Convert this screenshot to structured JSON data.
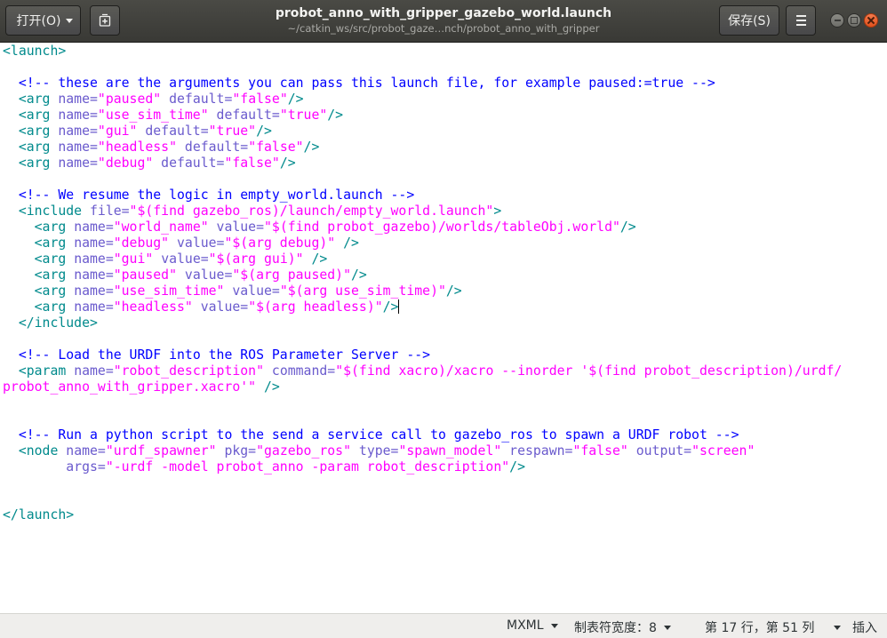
{
  "header": {
    "open_label": "打开(O)",
    "save_label": "保存(S)",
    "title": "probot_anno_with_gripper_gazebo_world.launch",
    "subtitle": "~/catkin_ws/src/probot_gaze…nch/probot_anno_with_gripper"
  },
  "editor": {
    "lines": [
      [
        [
          "t",
          "<launch>"
        ]
      ],
      [],
      [
        [
          "t",
          "  "
        ],
        [
          "c",
          "<!-- these are the arguments you can pass this launch file, for example paused:=true -->"
        ]
      ],
      [
        [
          "t",
          "  <arg "
        ],
        [
          "a",
          "name="
        ],
        [
          "v",
          "\"paused\""
        ],
        [
          "a",
          " default="
        ],
        [
          "v",
          "\"false\""
        ],
        [
          "t",
          "/>"
        ]
      ],
      [
        [
          "t",
          "  <arg "
        ],
        [
          "a",
          "name="
        ],
        [
          "v",
          "\"use_sim_time\""
        ],
        [
          "a",
          " default="
        ],
        [
          "v",
          "\"true\""
        ],
        [
          "t",
          "/>"
        ]
      ],
      [
        [
          "t",
          "  <arg "
        ],
        [
          "a",
          "name="
        ],
        [
          "v",
          "\"gui\""
        ],
        [
          "a",
          " default="
        ],
        [
          "v",
          "\"true\""
        ],
        [
          "t",
          "/>"
        ]
      ],
      [
        [
          "t",
          "  <arg "
        ],
        [
          "a",
          "name="
        ],
        [
          "v",
          "\"headless\""
        ],
        [
          "a",
          " default="
        ],
        [
          "v",
          "\"false\""
        ],
        [
          "t",
          "/>"
        ]
      ],
      [
        [
          "t",
          "  <arg "
        ],
        [
          "a",
          "name="
        ],
        [
          "v",
          "\"debug\""
        ],
        [
          "a",
          " default="
        ],
        [
          "v",
          "\"false\""
        ],
        [
          "t",
          "/>"
        ]
      ],
      [],
      [
        [
          "t",
          "  "
        ],
        [
          "c",
          "<!-- We resume the logic in empty_world.launch -->"
        ]
      ],
      [
        [
          "t",
          "  <include "
        ],
        [
          "a",
          "file="
        ],
        [
          "v",
          "\"$(find gazebo_ros)/launch/empty_world.launch\""
        ],
        [
          "t",
          ">"
        ]
      ],
      [
        [
          "t",
          "    <arg "
        ],
        [
          "a",
          "name="
        ],
        [
          "v",
          "\"world_name\""
        ],
        [
          "a",
          " value="
        ],
        [
          "v",
          "\"$(find probot_gazebo)/worlds/tableObj.world\""
        ],
        [
          "t",
          "/>"
        ]
      ],
      [
        [
          "t",
          "    <arg "
        ],
        [
          "a",
          "name="
        ],
        [
          "v",
          "\"debug\""
        ],
        [
          "a",
          " value="
        ],
        [
          "v",
          "\"$(arg debug)\""
        ],
        [
          "t",
          " />"
        ]
      ],
      [
        [
          "t",
          "    <arg "
        ],
        [
          "a",
          "name="
        ],
        [
          "v",
          "\"gui\""
        ],
        [
          "a",
          " value="
        ],
        [
          "v",
          "\"$(arg gui)\""
        ],
        [
          "t",
          " />"
        ]
      ],
      [
        [
          "t",
          "    <arg "
        ],
        [
          "a",
          "name="
        ],
        [
          "v",
          "\"paused\""
        ],
        [
          "a",
          " value="
        ],
        [
          "v",
          "\"$(arg paused)\""
        ],
        [
          "t",
          "/>"
        ]
      ],
      [
        [
          "t",
          "    <arg "
        ],
        [
          "a",
          "name="
        ],
        [
          "v",
          "\"use_sim_time\""
        ],
        [
          "a",
          " value="
        ],
        [
          "v",
          "\"$(arg use_sim_time)\""
        ],
        [
          "t",
          "/>"
        ]
      ],
      [
        [
          "t",
          "    <arg "
        ],
        [
          "a",
          "name="
        ],
        [
          "v",
          "\"headless\""
        ],
        [
          "a",
          " value="
        ],
        [
          "v",
          "\"$(arg headless)\""
        ],
        [
          "t",
          "/>"
        ],
        [
          "cursor",
          ""
        ]
      ],
      [
        [
          "t",
          "  </include>"
        ]
      ],
      [],
      [
        [
          "t",
          "  "
        ],
        [
          "c",
          "<!-- Load the URDF into the ROS Parameter Server -->"
        ]
      ],
      [
        [
          "t",
          "  <param "
        ],
        [
          "a",
          "name="
        ],
        [
          "v",
          "\"robot_description\""
        ],
        [
          "a",
          " command="
        ],
        [
          "v",
          "\"$(find xacro)/xacro --inorder '$(find probot_description)/urdf/"
        ]
      ],
      [
        [
          "v",
          "probot_anno_with_gripper.xacro'\""
        ],
        [
          "t",
          " />"
        ]
      ],
      [],
      [],
      [
        [
          "t",
          "  "
        ],
        [
          "c",
          "<!-- Run a python script to the send a service call to gazebo_ros to spawn a URDF robot -->"
        ]
      ],
      [
        [
          "t",
          "  <node "
        ],
        [
          "a",
          "name="
        ],
        [
          "v",
          "\"urdf_spawner\""
        ],
        [
          "a",
          " pkg="
        ],
        [
          "v",
          "\"gazebo_ros\""
        ],
        [
          "a",
          " type="
        ],
        [
          "v",
          "\"spawn_model\""
        ],
        [
          "a",
          " respawn="
        ],
        [
          "v",
          "\"false\""
        ],
        [
          "a",
          " output="
        ],
        [
          "v",
          "\"screen\""
        ]
      ],
      [
        [
          "a",
          "        args="
        ],
        [
          "v",
          "\"-urdf -model probot_anno -param robot_description\""
        ],
        [
          "t",
          "/>"
        ]
      ],
      [],
      [],
      [
        [
          "t",
          "</launch>"
        ]
      ]
    ]
  },
  "statusbar": {
    "language": "MXML",
    "tab_width": "制表符宽度：8",
    "position": "第 17 行，第 51 列",
    "mode": "插入"
  }
}
